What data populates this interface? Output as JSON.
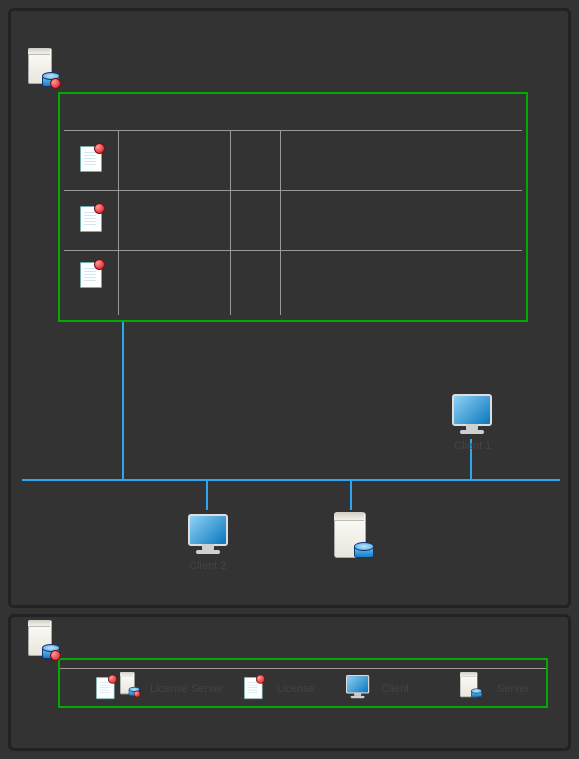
{
  "main": {
    "client1": "Client 1",
    "client2": "Client 2"
  },
  "legend": {
    "license_server": "License Server",
    "license": "License",
    "client": "Client",
    "server": "Server"
  }
}
